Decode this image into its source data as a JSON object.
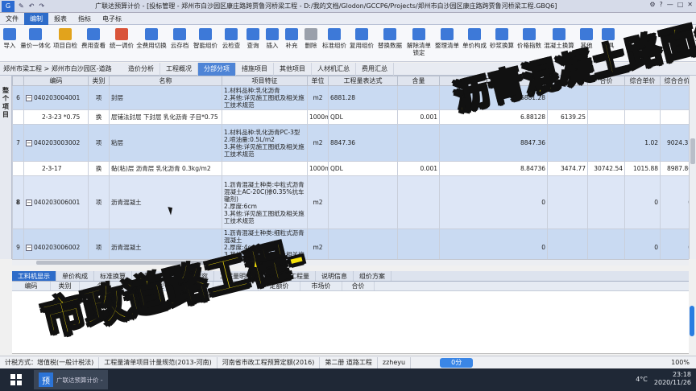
{
  "window": {
    "title": "广联达预算计价 - [投标管理 - 郑州市白沙园区康庄路跨贾鲁河桥梁工程 - D:/我的文档/Glodon/GCCP6/Projects/郑州市白沙园区康庄路跨贾鲁河桥梁工程.GBQ6]",
    "quick_access": [
      "✎",
      "↶",
      "↷"
    ],
    "right_icons": [
      "⚙",
      "?",
      "—",
      "□",
      "✕"
    ]
  },
  "menu": [
    "文件",
    "编制",
    "报表",
    "指标",
    "电子标"
  ],
  "menu_active_index": 1,
  "ribbon": [
    {
      "label": "导入",
      "icon": "import-icon",
      "color": "#3d79d8"
    },
    {
      "label": "量价一体化",
      "icon": "integrate-icon",
      "color": "#3d79d8"
    },
    {
      "label": "项目自检",
      "icon": "check-icon",
      "color": "#e2a31c"
    },
    {
      "label": "费用查看",
      "icon": "view-cost-icon",
      "color": "#3d79d8"
    },
    {
      "label": "统一调价",
      "icon": "adjust-price-icon",
      "color": "#d9543a"
    },
    {
      "label": "全费用切换",
      "icon": "switch-icon",
      "color": "#3d79d8"
    },
    {
      "label": "云存档",
      "icon": "cloud-save-icon",
      "color": "#3d79d8"
    },
    {
      "label": "智能组价",
      "icon": "smart-price-icon",
      "color": "#3d79d8"
    },
    {
      "label": "云检查",
      "icon": "cloud-check-icon",
      "color": "#3d79d8"
    },
    {
      "label": "查询",
      "icon": "search-icon",
      "color": "#3d79d8"
    },
    {
      "label": "插入",
      "icon": "insert-icon",
      "color": "#3d79d8"
    },
    {
      "label": "补充",
      "icon": "supplement-icon",
      "color": "#3d79d8"
    },
    {
      "label": "删除",
      "icon": "delete-icon",
      "color": "#9aa0ab"
    },
    {
      "label": "标准组价",
      "icon": "standard-price-icon",
      "color": "#3d79d8"
    },
    {
      "label": "复用组价",
      "icon": "reuse-price-icon",
      "color": "#3d79d8"
    },
    {
      "label": "替换数据",
      "icon": "replace-data-icon",
      "color": "#3d79d8"
    },
    {
      "label": "解除清单锁定",
      "icon": "unlock-icon",
      "color": "#3d79d8"
    },
    {
      "label": "整理清单",
      "icon": "organize-list-icon",
      "color": "#3d79d8"
    },
    {
      "label": "单价构成",
      "icon": "unit-price-icon",
      "color": "#3d79d8"
    },
    {
      "label": "砂浆换算",
      "icon": "mortar-icon",
      "color": "#3d79d8"
    },
    {
      "label": "价格指数",
      "icon": "price-index-icon",
      "color": "#3d79d8"
    },
    {
      "label": "混凝土换算",
      "icon": "concrete-icon",
      "color": "#3d79d8"
    },
    {
      "label": "其他",
      "icon": "other-icon",
      "color": "#3d79d8"
    },
    {
      "label": "工具",
      "icon": "tools-icon",
      "color": "#3d79d8"
    }
  ],
  "breadcrumb": "郑州市梁工程 > 郑州市白沙园区-道路",
  "tabs": [
    "造价分析",
    "工程概况",
    "分部分项",
    "措施项目",
    "其他项目",
    "人材机汇总",
    "费用汇总"
  ],
  "tabs_selected_index": 2,
  "left_panel_label": "整个项目",
  "grid": {
    "headers": [
      "",
      "编码",
      "类别",
      "名称",
      "项目特征",
      "单位",
      "工程量表达式",
      "含量",
      "工程量",
      "单价",
      "合价",
      "综合单价",
      "综合合价",
      "市"
    ],
    "rows": [
      {
        "type": "q",
        "no": "6",
        "code": "040203004001",
        "cat": "项",
        "name": "封层",
        "feature": "1.材料品种:乳化沥青\n2.其他:详见施工图纸及相关施工技术规范",
        "unit": "m2",
        "expr": "6881.28",
        "content": "",
        "qty": "6881.28",
        "price": "",
        "total": "",
        "uprice": "",
        "utotal": "",
        "last": "市"
      },
      {
        "type": "d",
        "no": "",
        "code": "2-3-23 *0.75",
        "cat": "换",
        "name": "层铺法封层 下封层 乳化沥青 子目*0.75",
        "feature": "",
        "unit": "1000m2",
        "expr": "QDL",
        "content": "0.001",
        "qty": "6.88128",
        "price": "6139.25",
        "total": "",
        "uprice": "",
        "utotal": "",
        "last": "市"
      },
      {
        "type": "q",
        "no": "7",
        "code": "040203003002",
        "cat": "项",
        "name": "粘层",
        "feature": "1.材料品种:乳化沥青PC-3型\n2.喷油量:0.5L/m2\n3.其他:详见施工图纸及相关施工技术规范",
        "unit": "m2",
        "expr": "8847.36",
        "content": "",
        "qty": "8847.36",
        "price": "",
        "total": "",
        "uprice": "1.02",
        "utotal": "9024.31",
        "last": "市"
      },
      {
        "type": "d",
        "no": "",
        "code": "2-3-17",
        "cat": "换",
        "name": "黏(粘)层 沥青层 乳化沥青 0.3kg/m2",
        "feature": "",
        "unit": "1000m2",
        "expr": "QDL",
        "content": "0.001",
        "qty": "8.84736",
        "price": "3474.77",
        "total": "30742.54",
        "uprice": "1015.88",
        "utotal": "8987.86",
        "last": "市"
      },
      {
        "type": "sel",
        "no": "8",
        "code": "040203006001",
        "cat": "项",
        "name": "沥青混凝土",
        "feature": "1.沥青混凝土种类:中粒式沥青混凝土AC-20C(掺0.35%抗车辙剂)\n2.厚度:6cm\n3.其他:详见施工图纸及相关施工技术规范",
        "unit": "m2",
        "expr": "",
        "content": "",
        "qty": "0",
        "price": "",
        "total": "",
        "uprice": "0",
        "utotal": "0",
        "last": "市"
      },
      {
        "type": "q",
        "no": "9",
        "code": "040203006002",
        "cat": "项",
        "name": "沥青混凝土",
        "feature": "1.沥青混凝土种类:细粒式沥青混凝土\n2.厚度:4cm\n3.其他:详见施工图纸及相关施工技术规范",
        "unit": "m2",
        "expr": "",
        "content": "",
        "qty": "0",
        "price": "",
        "total": "",
        "uprice": "0",
        "utotal": "0",
        "last": "市"
      }
    ]
  },
  "bottom_tabs": [
    "工料机显示",
    "单价构成",
    "标准换算",
    "换算信息",
    "特征及内容",
    "工程量明细",
    "反查图形工程量",
    "说明信息",
    "组价方案"
  ],
  "bottom_tabs_selected_index": 0,
  "bottom_headers": [
    "编码",
    "类别",
    "名称",
    "规格及型号",
    "单位",
    "数量",
    "定额价",
    "市场价",
    "合价"
  ],
  "status": {
    "items": [
      "计税方式：增值税(一般计税法)",
      "工程量清单项目计量规范(2013-河南)",
      "河南省市政工程预算定额(2016)",
      "第二册 道路工程",
      "zzheyu"
    ],
    "pill": "0分",
    "zoom": "100%"
  },
  "taskbar": {
    "app_icon": "预",
    "app_label": "广联达预算计价 -",
    "weather": "4°C",
    "time": "23:18",
    "date": "2020/11/26"
  },
  "overlay": {
    "line1": "沥青混凝土路面组价",
    "line2": "市政道路工程-"
  },
  "colors": {
    "accent": "#2e6cc9",
    "overlay_text": "#f5e10a"
  }
}
